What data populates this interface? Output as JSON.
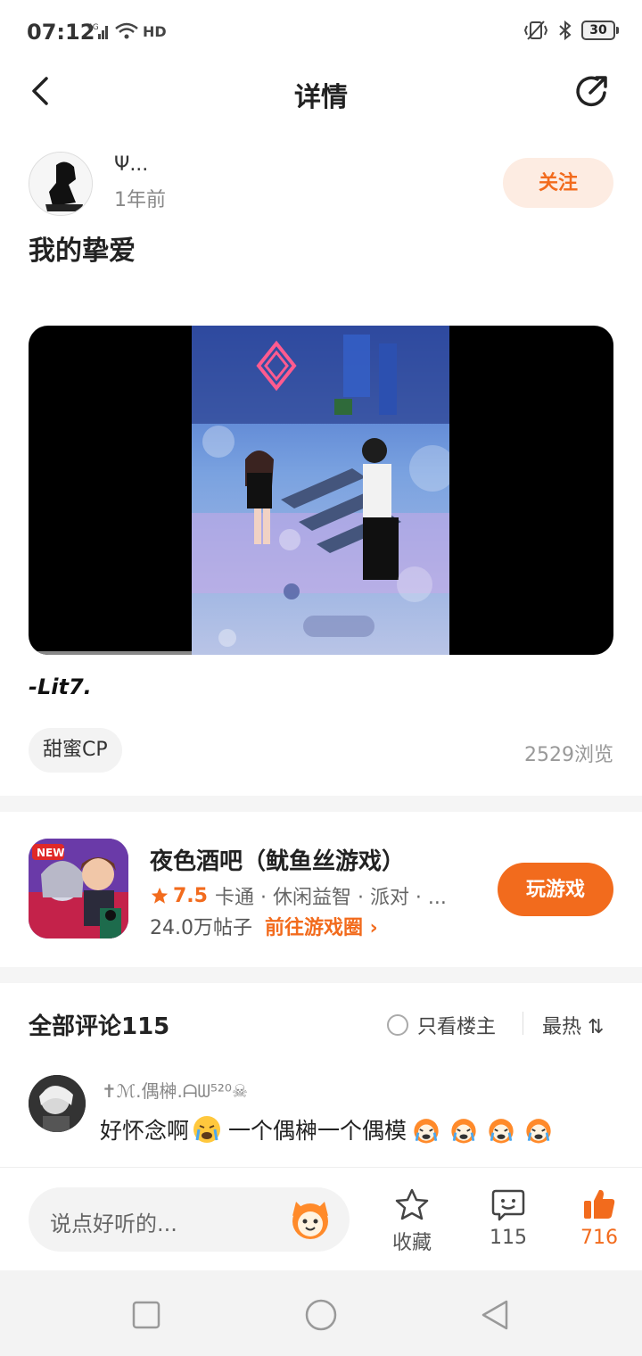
{
  "status_bar": {
    "time": "07:12",
    "network": "4G",
    "hd": "HD",
    "battery": "30"
  },
  "header": {
    "title": "详情"
  },
  "post": {
    "author_name": "Ψ...",
    "author_time": "1年前",
    "follow_label": "关注",
    "title": "我的挚爱",
    "body": "-Lit7.",
    "tag": "甜蜜CP",
    "views": "2529浏览"
  },
  "game": {
    "name": "夜色酒吧（鱿鱼丝游戏）",
    "rating": "7.5",
    "categories": "卡通 · 休闲益智 · 派对 · ...",
    "posts": "24.0万帖子",
    "link": "前往游戏圈 ›",
    "play_label": "玩游戏",
    "icon_badge": "NEW"
  },
  "comments": {
    "title": "全部评论115",
    "only_owner": "只看楼主",
    "sort": "最热 ⇅",
    "items": [
      {
        "name": "✝ℳ.偶榊.ᗩᗯ⁵²⁰☠",
        "text": "好怀念啊",
        "text2": "一个偶榊一个偶模"
      }
    ]
  },
  "bottom": {
    "placeholder": "说点好听的...",
    "favorite_label": "收藏",
    "comment_count": "115",
    "like_count": "716"
  },
  "colors": {
    "accent": "#f26b1d",
    "accent_light": "#fdece2"
  }
}
